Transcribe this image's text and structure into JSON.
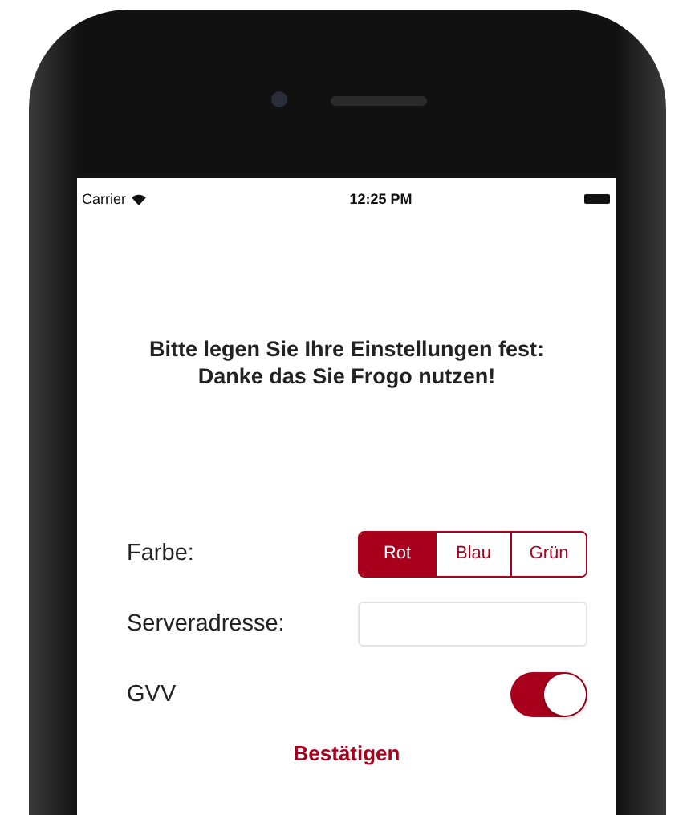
{
  "status_bar": {
    "carrier": "Carrier",
    "time": "12:25 PM"
  },
  "heading": [
    "Bitte legen Sie Ihre Einstellungen fest:",
    "Danke das Sie Frogo nutzen!"
  ],
  "settings": [
    {
      "kind": "segmented",
      "label": "Farbe:",
      "options": [
        {
          "label": "Rot",
          "selected": true
        },
        {
          "label": "Blau",
          "selected": false
        },
        {
          "label": "Grün",
          "selected": false
        }
      ]
    },
    {
      "kind": "text",
      "label": "Serveradresse:"
    },
    {
      "kind": "switch",
      "label": "GVV",
      "on": true
    }
  ],
  "confirm_button": "Bestätigen"
}
